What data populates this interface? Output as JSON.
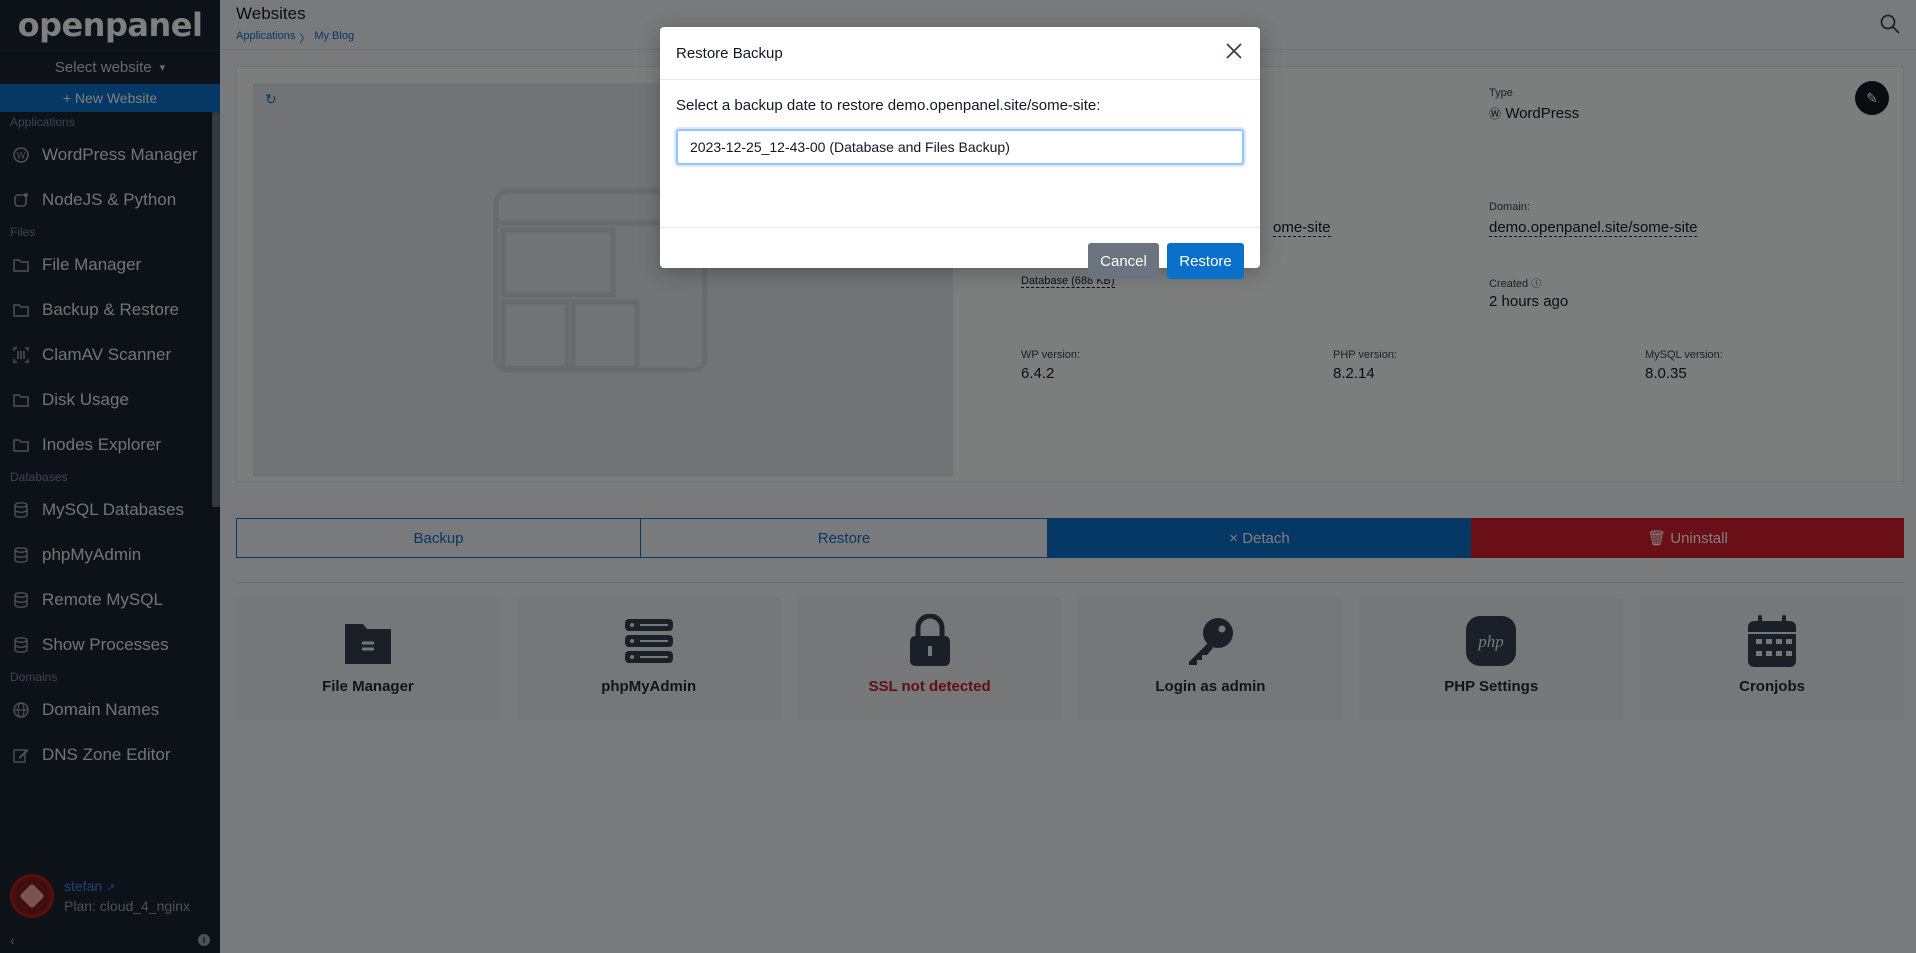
{
  "sidebar": {
    "logo": "openpanel",
    "select_website": "Select website",
    "new_website": "+ New Website",
    "sections": [
      {
        "label": "Applications",
        "items": [
          {
            "label": "WordPress Manager",
            "icon": "wordpress-icon"
          },
          {
            "label": "NodeJS & Python",
            "icon": "node-icon"
          }
        ]
      },
      {
        "label": "Files",
        "items": [
          {
            "label": "File Manager",
            "icon": "folder-icon"
          },
          {
            "label": "Backup & Restore",
            "icon": "folder-icon"
          },
          {
            "label": "ClamAV Scanner",
            "icon": "scanner-icon"
          },
          {
            "label": "Disk Usage",
            "icon": "folder-icon"
          },
          {
            "label": "Inodes Explorer",
            "icon": "folder-icon"
          }
        ]
      },
      {
        "label": "Databases",
        "items": [
          {
            "label": "MySQL Databases",
            "icon": "database-icon"
          },
          {
            "label": "phpMyAdmin",
            "icon": "database-icon"
          },
          {
            "label": "Remote MySQL",
            "icon": "database-icon"
          },
          {
            "label": "Show Processes",
            "icon": "database-icon"
          }
        ]
      },
      {
        "label": "Domains",
        "items": [
          {
            "label": "Domain Names",
            "icon": "globe-icon"
          },
          {
            "label": "DNS Zone Editor",
            "icon": "edit-icon"
          }
        ]
      }
    ],
    "user": {
      "name": "stefan",
      "plan": "Plan: cloud_4_nginx"
    }
  },
  "header": {
    "title": "Websites",
    "breadcrumb": [
      "Applications",
      "My Blog"
    ]
  },
  "site": {
    "type_label": "Type",
    "type_value": "WordPress",
    "path_fragment": "ome-site",
    "domain_label": "Domain:",
    "domain_value": "demo.openpanel.site/some-site",
    "database_link": "Database (688 KB)",
    "created_label": "Created",
    "created_value": "2 hours ago",
    "wp_label": "WP version:",
    "wp_value": "6.4.2",
    "php_label": "PHP version:",
    "php_value": "8.2.14",
    "mysql_label": "MySQL version:",
    "mysql_value": "8.0.35"
  },
  "actions": {
    "backup": "Backup",
    "restore": "Restore",
    "detach": "× Detach",
    "uninstall": "Uninstall"
  },
  "tools": [
    {
      "label": "File Manager",
      "icon": "folder-icon"
    },
    {
      "label": "phpMyAdmin",
      "icon": "server-icon"
    },
    {
      "label": "SSL not detected",
      "icon": "lock-icon"
    },
    {
      "label": "Login as admin",
      "icon": "key-icon"
    },
    {
      "label": "PHP Settings",
      "icon": "php-icon"
    },
    {
      "label": "Cronjobs",
      "icon": "calendar-icon"
    }
  ],
  "modal": {
    "title": "Restore Backup",
    "prompt": "Select a backup date to restore demo.openpanel.site/some-site:",
    "selected_backup": "2023-12-25_12-43-00 (Database and Files Backup)",
    "cancel": "Cancel",
    "restore": "Restore"
  },
  "colors": {
    "accent": "#0b70c9",
    "danger": "#d61f2c",
    "sidebar_bg": "#1b2430"
  }
}
